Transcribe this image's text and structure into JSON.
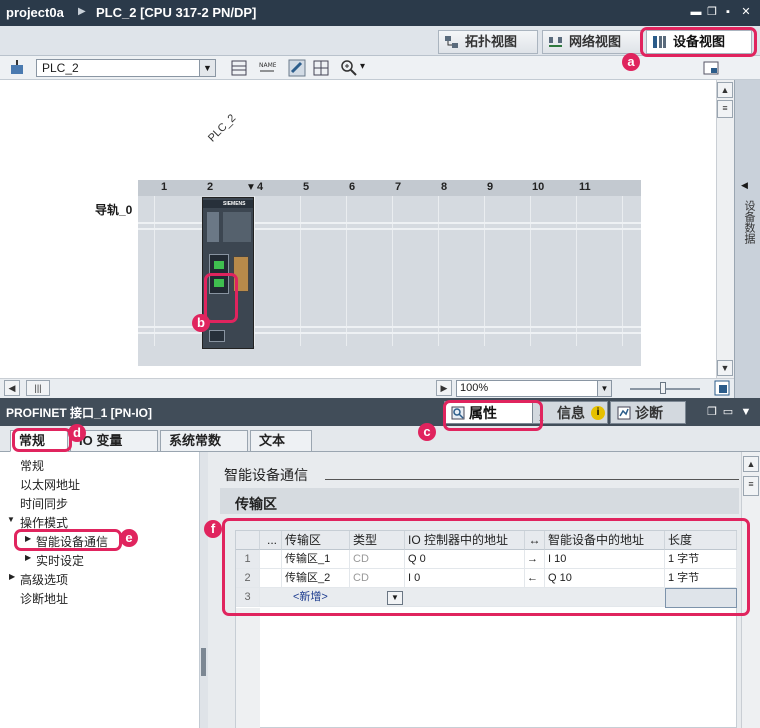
{
  "title_bar": {
    "project": "project0a",
    "device": "PLC_2 [CPU 317-2 PN/DP]"
  },
  "view_tabs": [
    {
      "label": "拓扑视图",
      "icon": "topology-view-icon"
    },
    {
      "label": "网络视图",
      "icon": "network-view-icon"
    },
    {
      "label": "设备视图",
      "icon": "device-view-icon",
      "active": true
    }
  ],
  "toolbar": {
    "device_selector": "PLC_2"
  },
  "canvas": {
    "device_label": "PLC_2",
    "rail_label": "导轨_0",
    "slots": [
      "1",
      "2",
      "4",
      "5",
      "6",
      "7",
      "8",
      "9",
      "10",
      "11"
    ],
    "cpu_brand": "SIEMENS",
    "zoom": "100%"
  },
  "side_panel": {
    "label": "设备数据"
  },
  "inspector": {
    "title": "PROFINET 接口_1 [PN-IO]",
    "tabs": [
      {
        "label": "属性",
        "icon": "properties-icon",
        "active": true
      },
      {
        "label": "信息",
        "icon": "info-icon"
      },
      {
        "label": "诊断",
        "icon": "diagnostics-icon"
      }
    ],
    "sub_tabs": [
      "常规",
      "IO 变量",
      "系统常数",
      "文本"
    ],
    "nav": [
      {
        "label": "常规",
        "level": 1
      },
      {
        "label": "以太网地址",
        "level": 1
      },
      {
        "label": "时间同步",
        "level": 1
      },
      {
        "label": "操作模式",
        "level": 0,
        "expanded": true
      },
      {
        "label": "智能设备通信",
        "level": 1,
        "selected": true
      },
      {
        "label": "实时设定",
        "level": 1
      },
      {
        "label": "高级选项",
        "level": 0
      },
      {
        "label": "诊断地址",
        "level": 0
      }
    ],
    "section_title": "智能设备通信",
    "subsection_title": "传输区",
    "table": {
      "columns": [
        "...",
        "传输区",
        "类型",
        "IO 控制器中的地址",
        "↔",
        "智能设备中的地址",
        "长度"
      ],
      "rows": [
        {
          "num": "1",
          "name": "传输区_1",
          "type": "CD",
          "ctrl_addr": "Q 0",
          "dir": "→",
          "dev_addr": "I 10",
          "length": "1 字节"
        },
        {
          "num": "2",
          "name": "传输区_2",
          "type": "CD",
          "ctrl_addr": "I 0",
          "dir": "←",
          "dev_addr": "Q 10",
          "length": "1 字节"
        },
        {
          "num": "3",
          "name": "<新增>",
          "type": "",
          "ctrl_addr": "",
          "dir": "",
          "dev_addr": "",
          "length": ""
        }
      ]
    }
  },
  "callouts": [
    "a",
    "b",
    "c",
    "d",
    "e",
    "f"
  ],
  "colors": {
    "callout": "#e0245e",
    "title_bar": "#2b3a4a",
    "inspector_bar": "#414d59"
  }
}
